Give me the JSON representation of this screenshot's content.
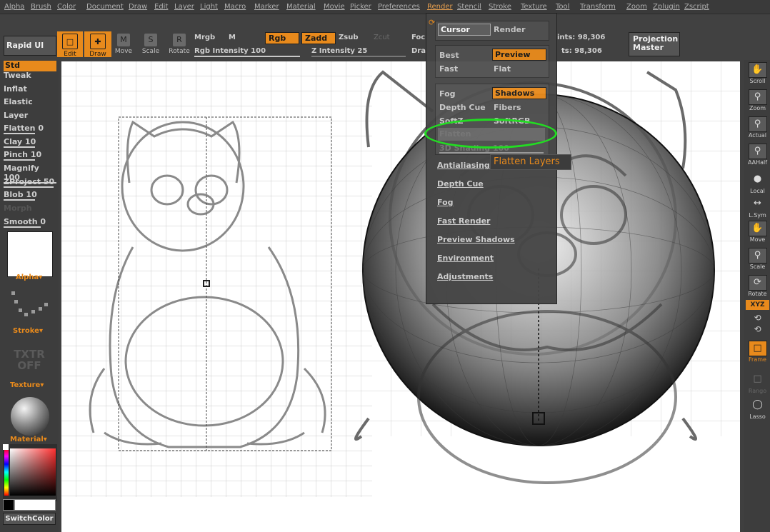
{
  "menu": [
    "Alpha",
    "Brush",
    "Color",
    "Document",
    "Draw",
    "Edit",
    "Layer",
    "Light",
    "Macro",
    "Marker",
    "Material",
    "Movie",
    "Picker",
    "Preferences",
    "Render",
    "Stencil",
    "Stroke",
    "Texture",
    "Tool",
    "Transform",
    "Zoom",
    "Zplugin",
    "Zscript"
  ],
  "menu_active": "Render",
  "toolbar": {
    "rapid_ui": "Rapid UI",
    "edit": "Edit",
    "draw": "Draw",
    "move": "Move",
    "scale": "Scale",
    "rotate": "Rotate",
    "mrgb": "Mrgb",
    "m": "M",
    "rgb": "Rgb",
    "zadd": "Zadd",
    "zsub": "Zsub",
    "zcut": "Zcut",
    "rgb_intensity": "Rgb Intensity 100",
    "z_intensity": "Z Intensity 25",
    "foc": "Foc",
    "dra": "Dra",
    "points1": "ints: 98,306",
    "points2": "ts: 98,306",
    "projection_master": "Projection Master"
  },
  "left_panel": {
    "brushes": [
      "Std",
      "Tweak",
      "Inflat",
      "Elastic",
      "Layer",
      "Flatten 0",
      "Clay 10",
      "Pinch 10",
      "Magnify 100",
      "ZProject 50",
      "Blob 10",
      "Morph",
      "Smooth 0"
    ],
    "selected": "Std",
    "alpha": "Alpha",
    "stroke": "Stroke",
    "txtr": "TXTR",
    "off": "OFF",
    "texture": "Texture",
    "material": "Material",
    "switch_color": "SwitchColor"
  },
  "right_panel": {
    "items": [
      "Scroll",
      "Zoom",
      "Actual",
      "AAHalf",
      "Local",
      "L.Sym",
      "Move",
      "Scale",
      "Rotate",
      "XYZ",
      "",
      "",
      "Frame",
      "Rango",
      "Lasso"
    ]
  },
  "render_menu": {
    "cursor": "Cursor",
    "render": "Render",
    "best": "Best",
    "preview": "Preview",
    "fast": "Fast",
    "flat": "Flat",
    "fog": "Fog",
    "shadows": "Shadows",
    "depth_cue": "Depth Cue",
    "fibers": "Fibers",
    "softz": "SoftZ",
    "softrgb": "SoftRGB",
    "flatten": "Flatten",
    "shading": "3D Shading 100",
    "links": [
      "Antialiasing",
      "Depth Cue",
      "Fog",
      "Fast Render",
      "Preview Shadows",
      "Environment",
      "Adjustments"
    ]
  },
  "tooltip": "Flatten Layers",
  "colors": {
    "accent": "#e88a1c",
    "highlight": "#22dd22",
    "panel": "#3f3f3f"
  }
}
